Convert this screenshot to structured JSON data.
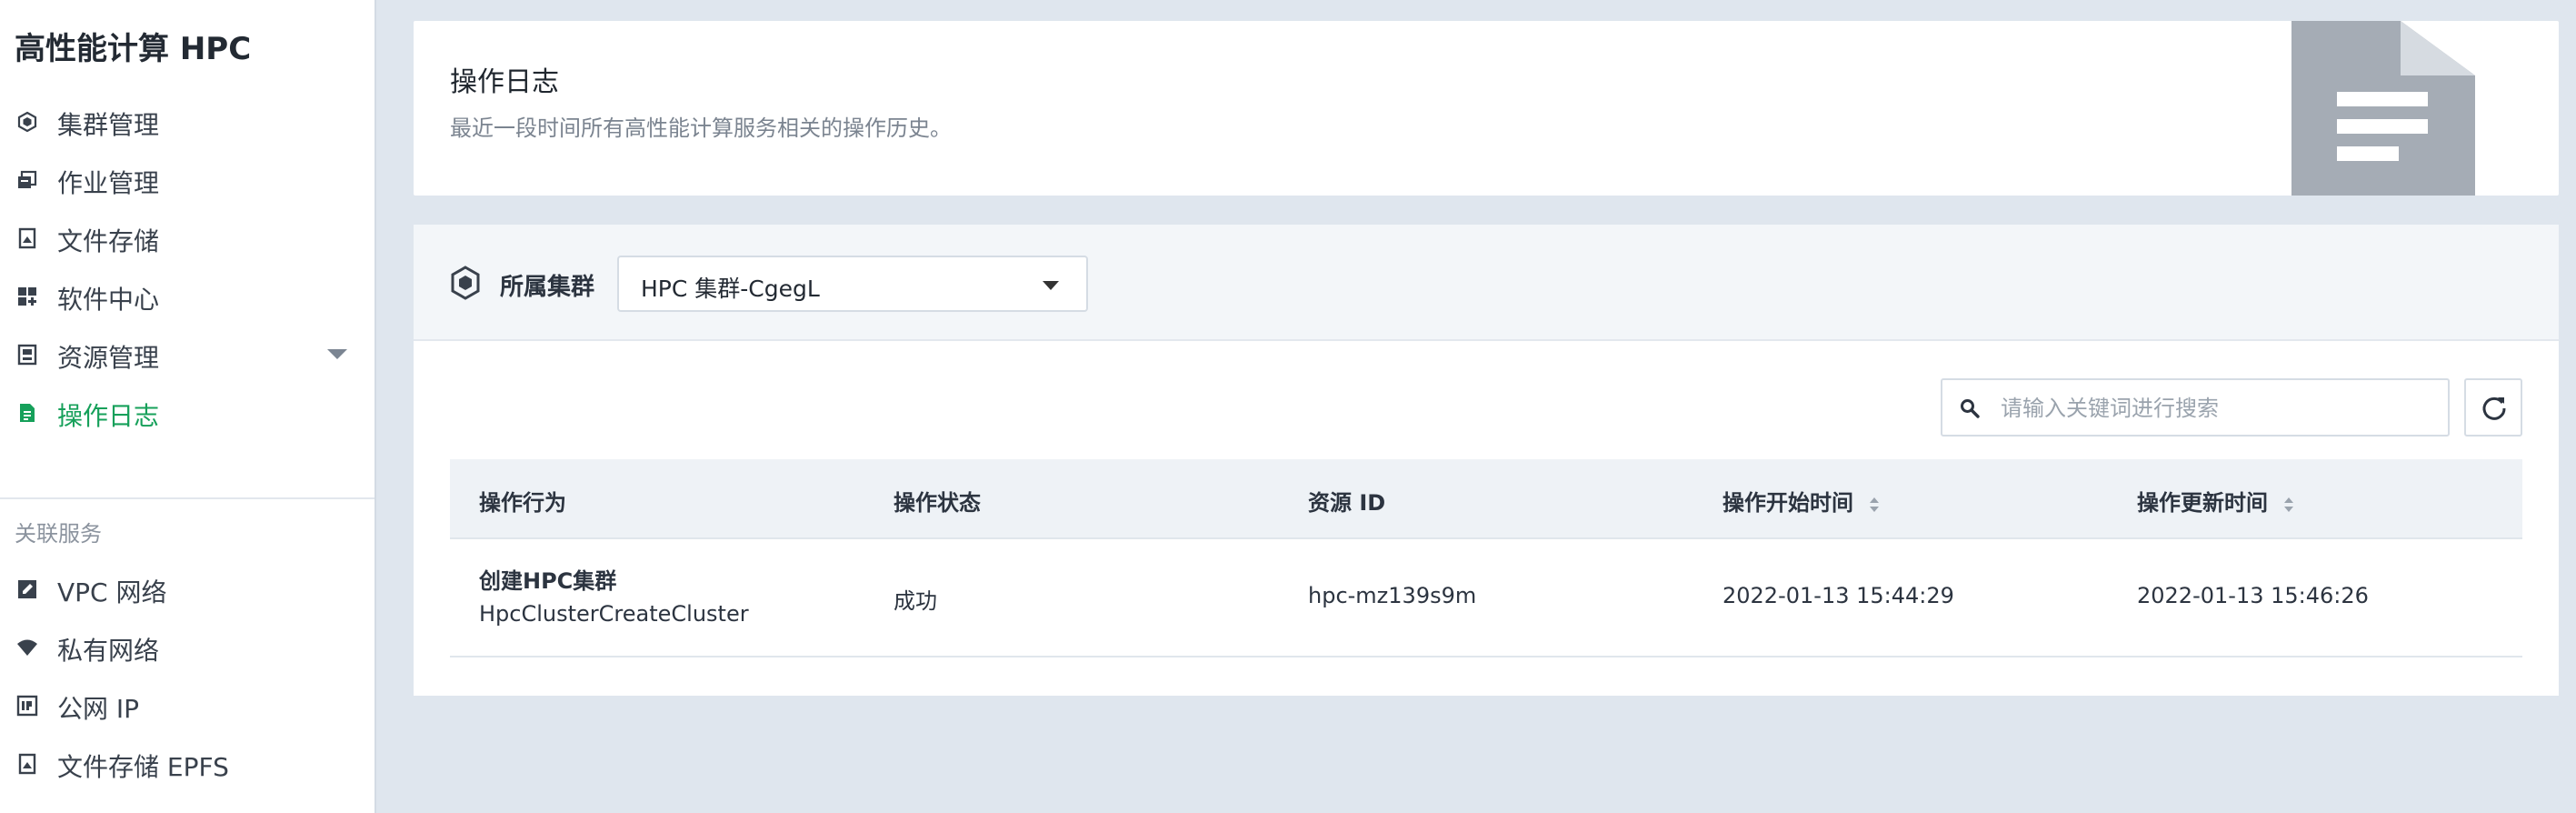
{
  "app": {
    "title": "高性能计算 HPC"
  },
  "sidebar": {
    "items": [
      {
        "label": "集群管理",
        "icon": "cluster-icon"
      },
      {
        "label": "作业管理",
        "icon": "job-icon"
      },
      {
        "label": "文件存储",
        "icon": "file-storage-icon"
      },
      {
        "label": "软件中心",
        "icon": "software-icon"
      },
      {
        "label": "资源管理",
        "icon": "resource-icon"
      },
      {
        "label": "操作日志",
        "icon": "log-icon",
        "active": true
      }
    ],
    "related_label": "关联服务",
    "related_items": [
      {
        "label": "VPC 网络",
        "icon": "vpc-icon"
      },
      {
        "label": "私有网络",
        "icon": "wifi-icon"
      },
      {
        "label": "公网 IP",
        "icon": "ip-icon"
      },
      {
        "label": "文件存储 EPFS",
        "icon": "epfs-icon"
      }
    ]
  },
  "header": {
    "title": "操作日志",
    "description": "最近一段时间所有高性能计算服务相关的操作历史。"
  },
  "filter": {
    "label": "所属集群",
    "selected": "HPC 集群-CgegL"
  },
  "search": {
    "placeholder": "请输入关键词进行搜索"
  },
  "table": {
    "columns": [
      "操作行为",
      "操作状态",
      "资源 ID",
      "操作开始时间",
      "操作更新时间"
    ],
    "rows": [
      {
        "action_title": "创建HPC集群",
        "action_code": "HpcClusterCreateCluster",
        "status": "成功",
        "resource_id": "hpc-mz139s9m",
        "start_time": "2022-01-13 15:44:29",
        "update_time": "2022-01-13 15:46:26"
      }
    ]
  },
  "colors": {
    "accent": "#16a05a",
    "background": "#dfe6ee"
  }
}
